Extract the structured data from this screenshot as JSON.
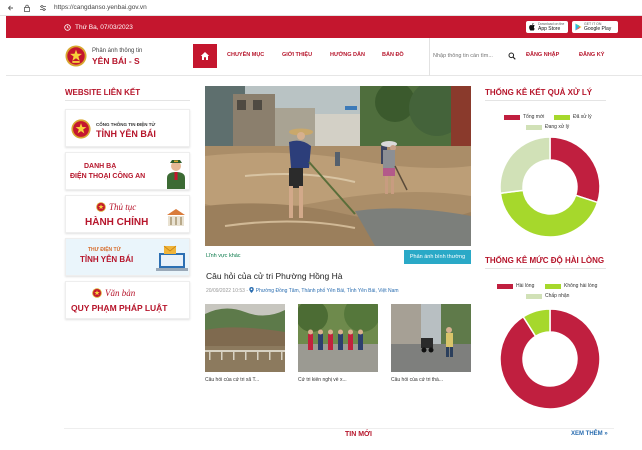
{
  "browser": {
    "url": "https://cangdanso.yenbai.gov.vn",
    "back_icon": "back-arrow-icon",
    "lock_icon": "lock-icon",
    "settings_icon": "site-settings-icon"
  },
  "topbar": {
    "date": "Thứ Ba, 07/03/2023",
    "app_store_small": "Download on the",
    "app_store": "App Store",
    "google_play_small": "GET IT ON",
    "google_play": "Google Play"
  },
  "header": {
    "logo_line1": "Phản ánh thông tin",
    "logo_line2": "YÊN BÁI - S",
    "nav": [
      "CHUYÊN MỤC",
      "GIỚI THIỆU",
      "HƯỚNG DẪN",
      "BẢN ĐỒ"
    ],
    "search_placeholder": "Nhập thông tin cần tìm...",
    "login": "ĐĂNG NHẬP",
    "register": "ĐĂNG KÝ"
  },
  "sidebar": {
    "title": "WEBSITE LIÊN KẾT",
    "links": [
      {
        "small": "CỔNG THÔNG TIN ĐIỆN TỬ",
        "big": "TỈNH YÊN BÁI"
      },
      {
        "line1": "DANH BẠ",
        "line2": "ĐIỆN THOẠI CÔNG AN"
      },
      {
        "italic": "Thủ tục",
        "big": "HÀNH CHÍNH"
      },
      {
        "line1": "THƯ ĐIỆN TỬ",
        "line2": "TỈNH YÊN BÁI"
      },
      {
        "italic": "Văn bản",
        "big": "QUY PHẠM PHÁP LUẬT"
      }
    ]
  },
  "main": {
    "field_label": "Lĩnh vực khác",
    "type_label": "Phản ánh bình thường",
    "news_title": "Câu hỏi của cử tri Phường Hồng Hà",
    "news_date": "20/09/2022 10:53 -",
    "news_location": "Phường Đồng Tâm, Thành phố Yên Bái, Tỉnh Yên Bái, Việt Nam",
    "thumb_captions": [
      "Câu hỏi của cử tri xã T...",
      "Cử tri kiến nghị về x...",
      "Câu hỏi của cử tri thà..."
    ]
  },
  "stats_result": {
    "title": "THỐNG KÊ KẾT QUẢ XỬ LÝ",
    "legend": [
      "Tổng mới",
      "Đã xử lý",
      "Đang xử lý"
    ],
    "colors": [
      "#c01f3f",
      "#a6d82c",
      "#d1e1b7"
    ]
  },
  "stats_satisfaction": {
    "title": "THỐNG KÊ MỨC ĐỘ HÀI LÒNG",
    "legend": [
      "Hài lòng",
      "Không hài lòng",
      "Chấp nhận"
    ],
    "colors": [
      "#c01f3f",
      "#a6d82c",
      "#d1e1b7"
    ]
  },
  "chart_data": [
    {
      "type": "pie",
      "title": "THỐNG KÊ KẾT QUẢ XỬ LÝ",
      "categories": [
        "Tổng mới",
        "Đã xử lý",
        "Đang xử lý"
      ],
      "values": [
        30,
        43,
        27
      ],
      "donut": true,
      "legend": "top"
    },
    {
      "type": "pie",
      "title": "THỐNG KÊ MỨC ĐỘ HÀI LÒNG",
      "categories": [
        "Hài lòng",
        "Không hài lòng",
        "Chấp nhận"
      ],
      "values": [
        91,
        9,
        0
      ],
      "donut": true,
      "legend": "top"
    }
  ],
  "footer": {
    "section": "TIN MỚI",
    "more": "XEM THÊM »"
  }
}
